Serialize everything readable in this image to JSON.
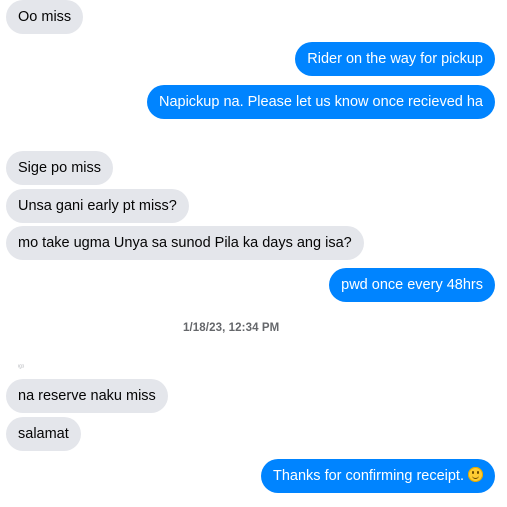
{
  "messages": [
    {
      "text": "Oo miss"
    },
    {
      "text": "Rider on the way for pickup"
    },
    {
      "text": "Napickup na. Please let us know once recieved ha"
    },
    {
      "text": "Sige po miss"
    },
    {
      "text": "Unsa gani early pt miss?"
    },
    {
      "text": "mo take ugma Unya sa sunod Pila ka days ang isa?"
    },
    {
      "text": "pwd once every 48hrs"
    },
    {
      "text": "na reserve naku miss"
    },
    {
      "text": "salamat"
    },
    {
      "text": "Thanks for confirming receipt.",
      "emoji": "smiling-face-icon"
    }
  ],
  "timestamp": "1/18/23, 12:34 PM",
  "sender_hint": "ᶦᵍᵓ",
  "colors": {
    "incoming_bubble": "#e4e6eb",
    "outgoing_bubble": "#0084ff",
    "timestamp_text": "#65676b"
  }
}
